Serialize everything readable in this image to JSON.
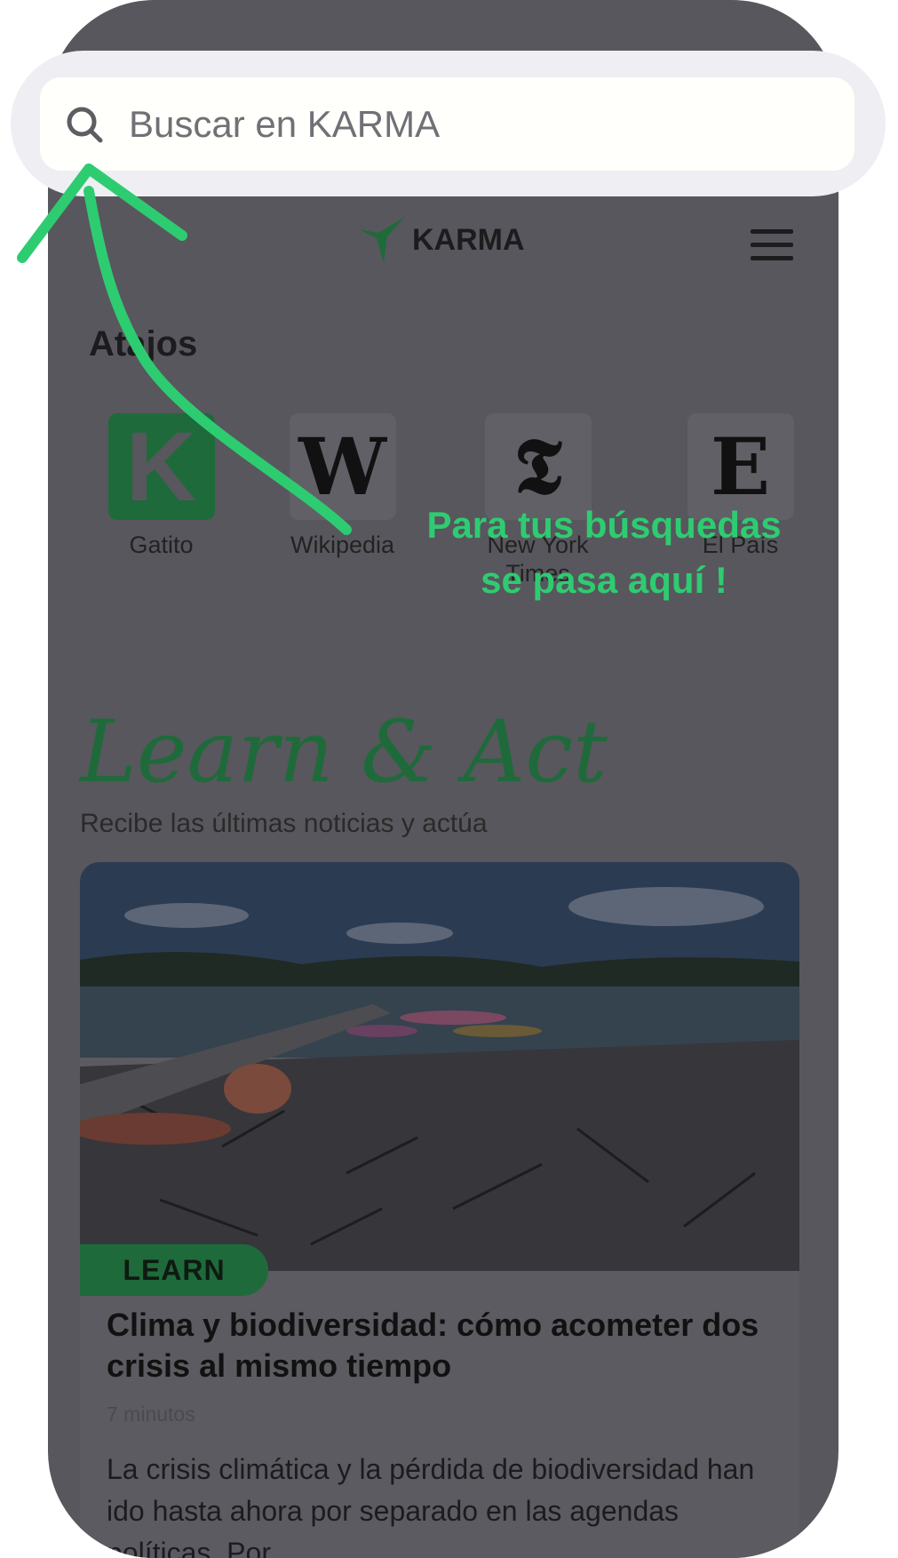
{
  "search": {
    "placeholder": "Buscar en KARMA"
  },
  "header": {
    "logo_text": "KARMA"
  },
  "shortcuts": {
    "title": "Atajos",
    "items": [
      {
        "glyph": "K",
        "label": "Gatito"
      },
      {
        "glyph": "W",
        "label": "Wikipedia"
      },
      {
        "glyph": "𝕿",
        "label": "New York Times"
      },
      {
        "glyph": "E",
        "label": "El País"
      }
    ]
  },
  "learn": {
    "title": "Learn & Act",
    "subtitle": "Recibe las últimas noticias y actúa"
  },
  "card": {
    "badge": "LEARN",
    "title": "Clima y biodiversidad: cómo acometer dos crisis al mismo tiempo",
    "meta": "7 minutos",
    "body": "La crisis climática y la pérdida de biodiversidad han ido hasta ahora por separado en las agendas políticas. Por..."
  },
  "annotation": {
    "line1": "Para tus búsquedas",
    "line2": "se pasa aquí !"
  },
  "colors": {
    "accent_green": "#2ecc71",
    "brand_green": "#1f6a3a",
    "overlay": "#58575d"
  }
}
